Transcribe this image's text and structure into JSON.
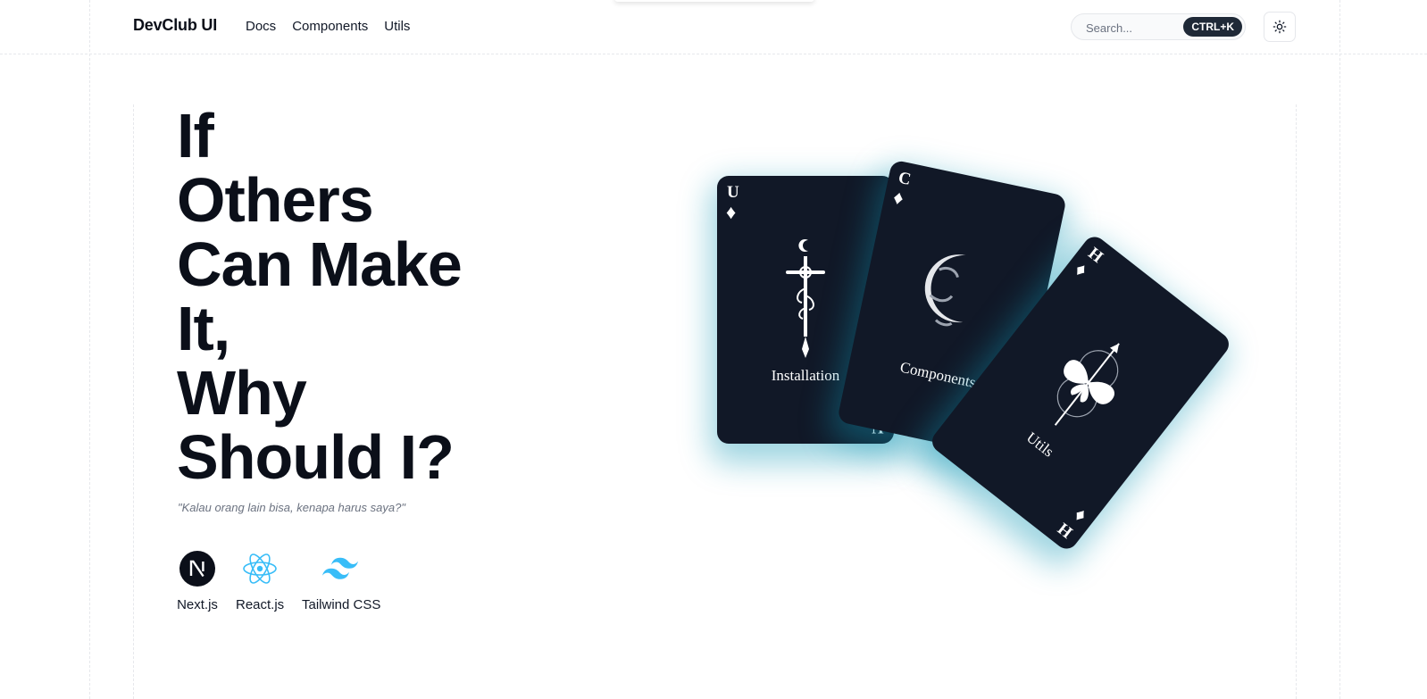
{
  "header": {
    "brand": "DevClub UI",
    "nav": [
      "Docs",
      "Components",
      "Utils"
    ],
    "search_placeholder": "Search...",
    "shortcut": "CTRL+K",
    "theme_toggle_icon": "sun-icon"
  },
  "hero": {
    "headline_lines": [
      "If",
      "Others",
      "Can Make",
      "It,",
      "Why",
      "Should I?"
    ],
    "tagline": "\"Kalau orang lain bisa, kenapa harus saya?\"",
    "techs": [
      {
        "label": "Next.js",
        "icon": "nextjs-icon"
      },
      {
        "label": "React.js",
        "icon": "react-icon"
      },
      {
        "label": "Tailwind CSS",
        "icon": "tailwind-icon"
      }
    ]
  },
  "cards": [
    {
      "rank": "U",
      "suit": "♦",
      "title": "Installation",
      "art": "dagger-moon-icon"
    },
    {
      "rank": "C",
      "suit": "♦",
      "title": "Components",
      "art": "crescent-moon-icon"
    },
    {
      "rank": "H",
      "suit": "♦",
      "title": "Utils",
      "art": "butterfly-arrow-icon"
    }
  ],
  "colors": {
    "card_bg": "#111827",
    "card_glow": "#1096b4",
    "text": "#0b0f19",
    "muted": "#6b7280"
  }
}
